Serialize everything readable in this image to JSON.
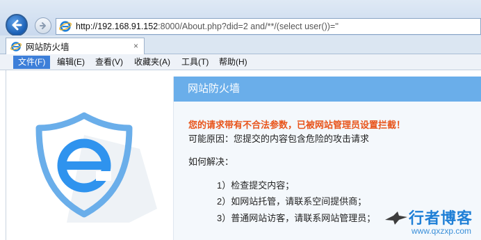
{
  "address_bar": {
    "host": "http://192.168.91.152",
    "rest": ":8000/About.php?did=2 and/**/(select user())=''"
  },
  "tab": {
    "title": "网站防火墙",
    "close": "×"
  },
  "menu": {
    "items": [
      "文件(F)",
      "编辑(E)",
      "查看(V)",
      "收藏夹(A)",
      "工具(T)",
      "帮助(H)"
    ],
    "active_index": 0
  },
  "page": {
    "header": "网站防火墙",
    "warning": "您的请求带有不合法参数，已被网站管理员设置拦截！",
    "reason": "可能原因：您提交的内容包含危险的攻击请求",
    "how_to": "如何解决：",
    "steps": [
      "1）检查提交内容；",
      "2）如网站托管，请联系空间提供商；",
      "3）普通网站访客，请联系网站管理员；"
    ]
  },
  "watermark": {
    "name": "行者博客",
    "url": "www.qxzxp.com"
  },
  "colors": {
    "accent": "#6aaeea",
    "warning": "#e8541a",
    "menu_active": "#3d7fd9"
  }
}
